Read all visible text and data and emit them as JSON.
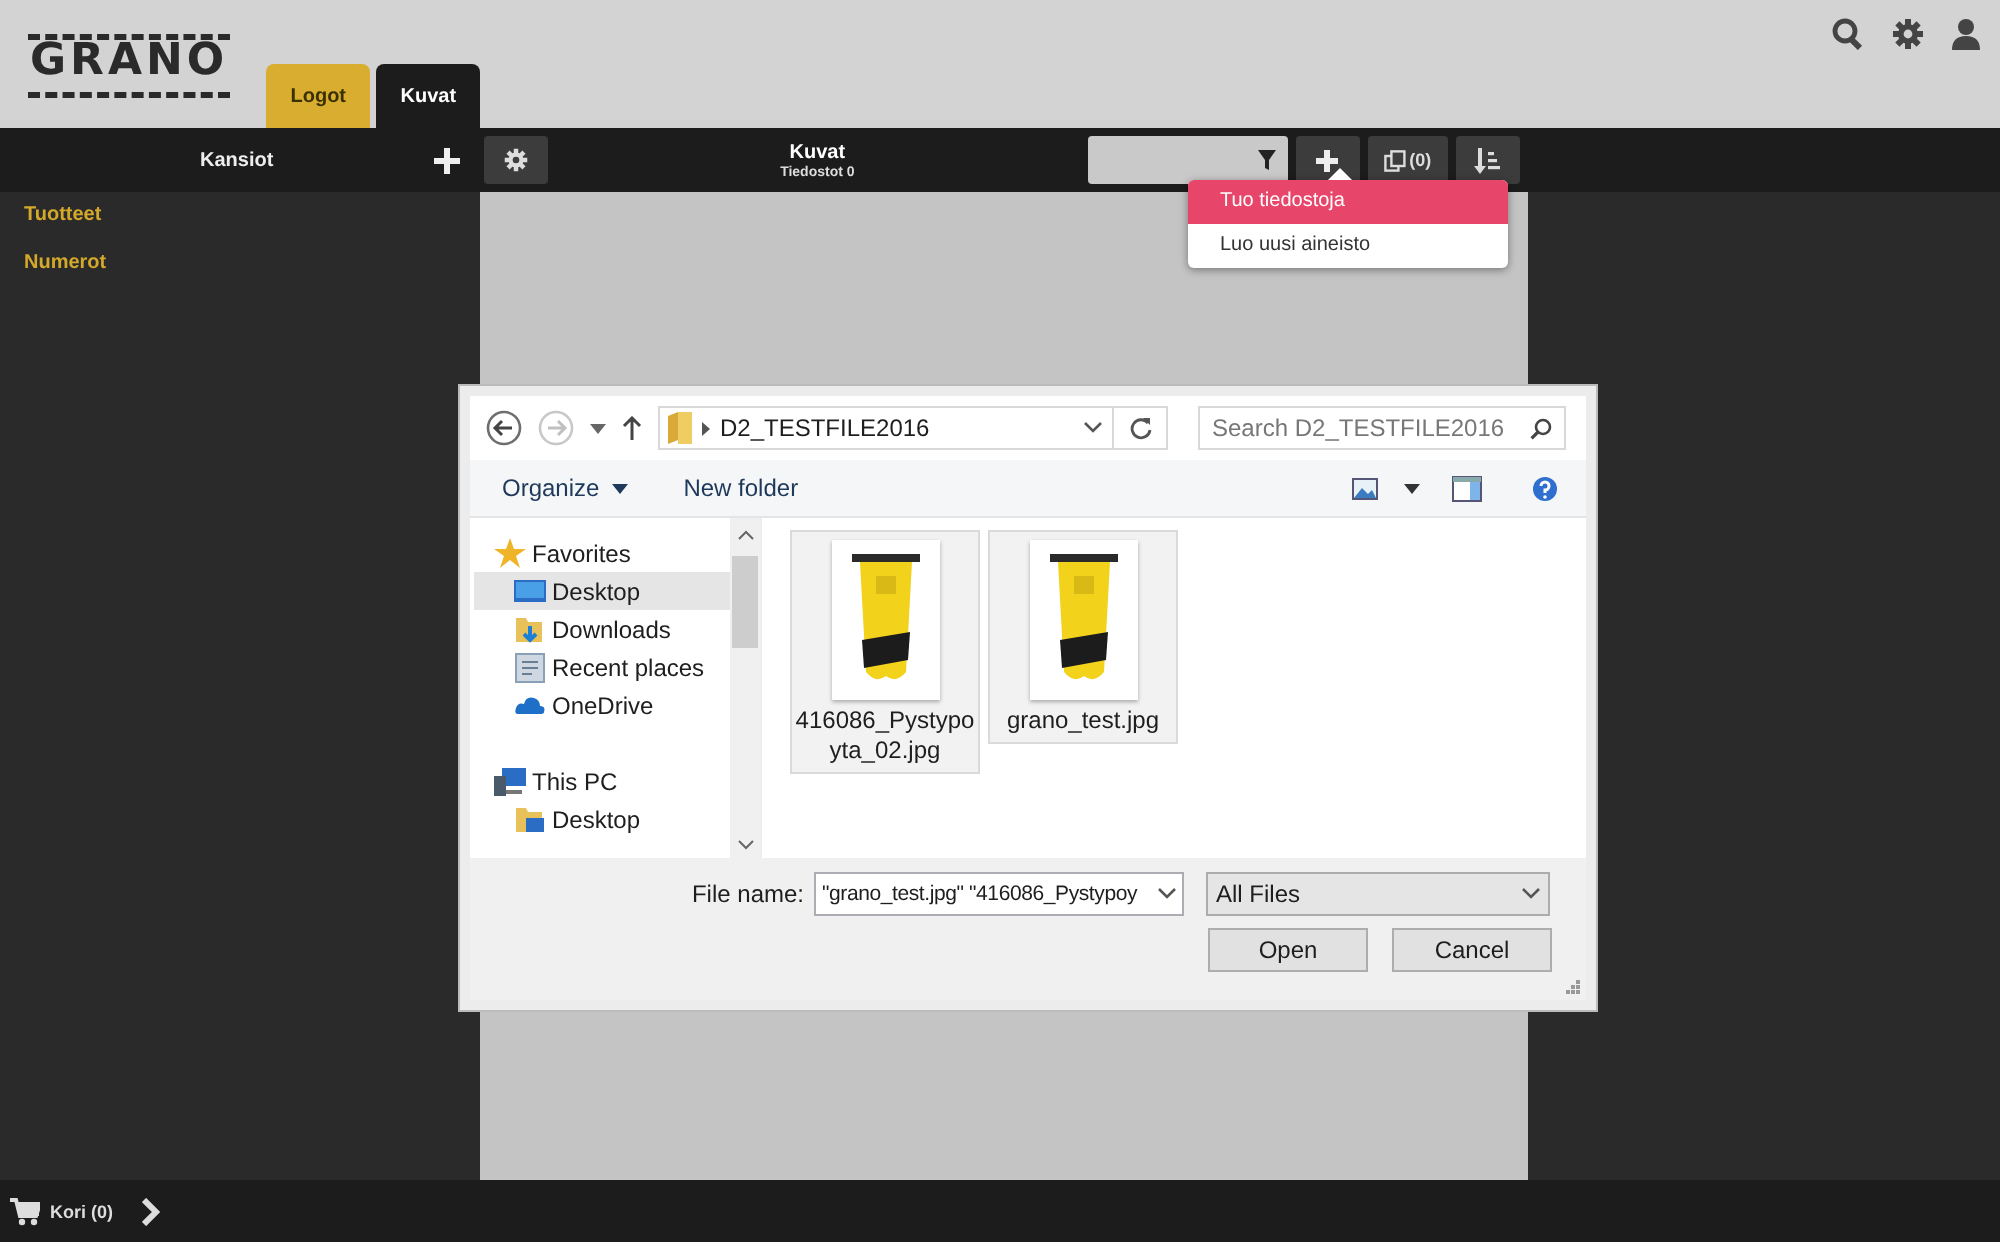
{
  "logo": "GRANO",
  "tabs": [
    {
      "label": "Logot",
      "selected": false
    },
    {
      "label": "Kuvat",
      "selected": true
    }
  ],
  "toolbar": {
    "folders_title": "Kansiot",
    "title": "Kuvat",
    "subtitle": "Tiedostot 0",
    "selection_count": "(0)"
  },
  "folders": [
    {
      "label": "Tuotteet"
    },
    {
      "label": "Numerot"
    }
  ],
  "add_menu": [
    {
      "label": "Tuo tiedostoja",
      "selected": true
    },
    {
      "label": "Luo uusi aineisto",
      "selected": false
    }
  ],
  "file_dialog": {
    "path": "D2_TESTFILE2016",
    "search_placeholder": "Search D2_TESTFILE2016",
    "organize": "Organize",
    "new_folder": "New folder",
    "nav": [
      {
        "label": "Favorites",
        "children": [
          {
            "label": "Desktop",
            "selected": true
          },
          {
            "label": "Downloads",
            "selected": false
          },
          {
            "label": "Recent places",
            "selected": false
          },
          {
            "label": "OneDrive",
            "selected": false
          }
        ]
      },
      {
        "label": "This PC",
        "children": [
          {
            "label": "Desktop",
            "selected": false
          }
        ]
      }
    ],
    "files": [
      {
        "name": "416086_Pystypoyta_02.jpg",
        "selected": true
      },
      {
        "name": "grano_test.jpg",
        "selected": true
      }
    ],
    "file_name_label": "File name:",
    "file_name": "\"grano_test.jpg\" \"416086_Pystypoy",
    "file_type": "All Files",
    "buttons": [
      "Open",
      "Cancel"
    ]
  },
  "cart": "Kori (0)"
}
